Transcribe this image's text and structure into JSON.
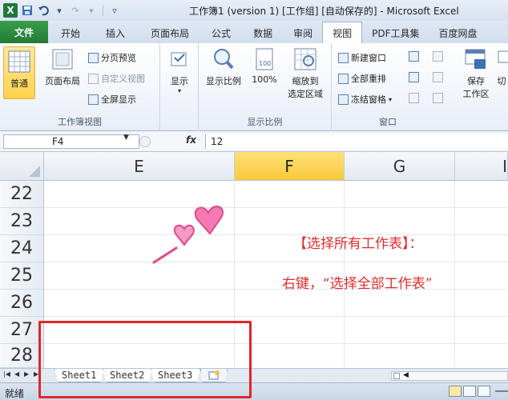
{
  "titlebar": {
    "app_logo": "X",
    "title": "工作簿1 (version 1)  [工作组] [自动保存的] - Microsoft Excel"
  },
  "tabs": [
    {
      "label": "文件"
    },
    {
      "label": "开始"
    },
    {
      "label": "插入"
    },
    {
      "label": "页面布局"
    },
    {
      "label": "公式"
    },
    {
      "label": "数据"
    },
    {
      "label": "审阅"
    },
    {
      "label": "视图"
    },
    {
      "label": "PDF工具集"
    },
    {
      "label": "百度网盘"
    }
  ],
  "ribbon": {
    "workbook_views": {
      "group_label": "工作簿视图",
      "normal": "普通",
      "page_layout": "页面布局",
      "page_break": "分页预览",
      "custom_views": "自定义视图",
      "full_screen": "全屏显示"
    },
    "show": {
      "label": "显示"
    },
    "zoom": {
      "group_label": "显示比例",
      "zoom": "显示比例",
      "hundred": "100%",
      "zoom_selection_line1": "缩放到",
      "zoom_selection_line2": "选定区域"
    },
    "window": {
      "group_label": "窗口",
      "new_window": "新建窗口",
      "arrange_all": "全部重排",
      "freeze_panes": "冻结窗格",
      "save_workspace_line1": "保存",
      "save_workspace_line2": "工作区",
      "switch": "切"
    }
  },
  "formula_bar": {
    "name_box": "F4",
    "fx": "fx",
    "value": "12"
  },
  "columns": [
    "E",
    "F",
    "G",
    "I"
  ],
  "rows": [
    "22",
    "23",
    "24",
    "25",
    "26",
    "27",
    "28"
  ],
  "annotation": {
    "line1": "【选择所有工作表】：",
    "line2": "右键，“选择全部工作表”"
  },
  "sheets": [
    "Sheet1",
    "Sheet2",
    "Sheet3"
  ],
  "status": {
    "text": "就绪"
  }
}
